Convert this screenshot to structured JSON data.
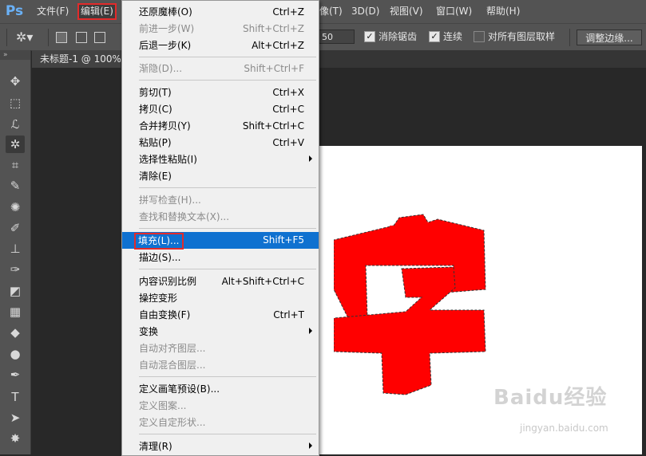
{
  "app": {
    "logo": "Ps"
  },
  "menubar": {
    "items": [
      {
        "id": "file",
        "label": "文件(F)"
      },
      {
        "id": "edit",
        "label": "编辑(E)"
      },
      {
        "id": "image",
        "label": "像(T)"
      },
      {
        "id": "3d",
        "label": "3D(D)"
      },
      {
        "id": "view",
        "label": "视图(V)"
      },
      {
        "id": "window",
        "label": "窗口(W)"
      },
      {
        "id": "help",
        "label": "帮助(H)"
      }
    ]
  },
  "options": {
    "tolerance_value": "50",
    "anti_alias_label": "消除锯齿",
    "contiguous_label": "连续",
    "sample_all_label": "对所有图层取样",
    "refine_edge_label": "调整边缘..."
  },
  "document": {
    "tab_title": "未标题-1 @ 100%"
  },
  "canvas": {
    "glyph_color": "#ff0000"
  },
  "watermark": {
    "main": "Baidu经验",
    "sub": "jingyan.baidu.com"
  },
  "edit_menu": {
    "items": [
      {
        "label": "还原魔棒(O)",
        "shortcut": "Ctrl+Z",
        "enabled": true
      },
      {
        "label": "前进一步(W)",
        "shortcut": "Shift+Ctrl+Z",
        "enabled": false
      },
      {
        "label": "后退一步(K)",
        "shortcut": "Alt+Ctrl+Z",
        "enabled": true
      },
      {
        "label": "渐隐(D)...",
        "shortcut": "Shift+Ctrl+F",
        "enabled": false
      },
      {
        "label": "剪切(T)",
        "shortcut": "Ctrl+X",
        "enabled": true
      },
      {
        "label": "拷贝(C)",
        "shortcut": "Ctrl+C",
        "enabled": true
      },
      {
        "label": "合并拷贝(Y)",
        "shortcut": "Shift+Ctrl+C",
        "enabled": true
      },
      {
        "label": "粘贴(P)",
        "shortcut": "Ctrl+V",
        "enabled": true
      },
      {
        "label": "选择性粘贴(I)",
        "shortcut": "",
        "enabled": true
      },
      {
        "label": "清除(E)",
        "shortcut": "",
        "enabled": true
      },
      {
        "label": "拼写检查(H)...",
        "shortcut": "",
        "enabled": false
      },
      {
        "label": "查找和替换文本(X)...",
        "shortcut": "",
        "enabled": false
      },
      {
        "label": "填充(L)...",
        "shortcut": "Shift+F5",
        "enabled": true,
        "highlighted": true
      },
      {
        "label": "描边(S)...",
        "shortcut": "",
        "enabled": true
      },
      {
        "label": "内容识别比例",
        "shortcut": "Alt+Shift+Ctrl+C",
        "enabled": true
      },
      {
        "label": "操控变形",
        "shortcut": "",
        "enabled": true
      },
      {
        "label": "自由变换(F)",
        "shortcut": "Ctrl+T",
        "enabled": true
      },
      {
        "label": "变换",
        "shortcut": "",
        "enabled": true
      },
      {
        "label": "自动对齐图层...",
        "shortcut": "",
        "enabled": false
      },
      {
        "label": "自动混合图层...",
        "shortcut": "",
        "enabled": false
      },
      {
        "label": "定义画笔预设(B)...",
        "shortcut": "",
        "enabled": true
      },
      {
        "label": "定义图案...",
        "shortcut": "",
        "enabled": false
      },
      {
        "label": "定义自定形状...",
        "shortcut": "",
        "enabled": false
      },
      {
        "label": "清理(R)",
        "shortcut": "",
        "enabled": true
      }
    ]
  }
}
